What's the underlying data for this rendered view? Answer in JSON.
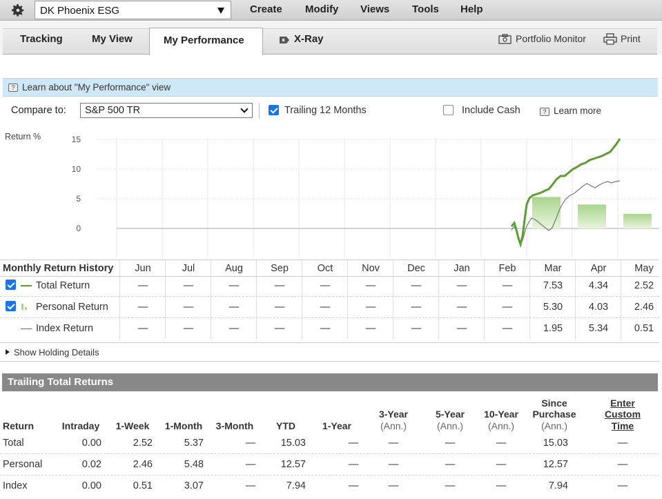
{
  "menubar": {
    "portfolio": "DK Phoenix ESG",
    "menus": [
      "Create",
      "Modify",
      "Views",
      "Tools",
      "Help"
    ]
  },
  "tabs": {
    "items": [
      "Tracking",
      "My View",
      "My Performance",
      "X-Ray"
    ],
    "active": "My Performance",
    "tools": [
      "Portfolio Monitor",
      "Print"
    ]
  },
  "learn": {
    "text": "Learn about \"My Performance\" view"
  },
  "compare": {
    "label": "Compare to:",
    "selected": "S&P 500 TR",
    "trailing_label": "Trailing 12 Months",
    "trailing_checked": true,
    "cash_label": "Include Cash",
    "cash_checked": false,
    "learn_more": "Learn more"
  },
  "chart_data": {
    "type": "line",
    "ylabel": "Return %",
    "yticks": [
      0,
      5,
      10,
      15
    ],
    "ylim": [
      -5,
      20
    ],
    "grid": true,
    "series": [
      {
        "name": "Total Return",
        "color": "#5a9e32",
        "kind": "line"
      },
      {
        "name": "Personal Return",
        "color": "#b9dd99",
        "kind": "bar"
      },
      {
        "name": "Index Return",
        "color": "#666666",
        "kind": "line"
      }
    ],
    "bars": [
      {
        "month": "Mar",
        "value": 5.3
      },
      {
        "month": "Apr",
        "value": 4.03
      },
      {
        "month": "May",
        "value": 2.46
      }
    ]
  },
  "monthly": {
    "title": "Monthly Return History",
    "months": [
      "Jun",
      "Jul",
      "Aug",
      "Sep",
      "Oct",
      "Nov",
      "Dec",
      "Jan",
      "Feb",
      "Mar",
      "Apr",
      "May"
    ],
    "rows": [
      {
        "label": "Total Return",
        "checked": true,
        "values": [
          "—",
          "—",
          "—",
          "—",
          "—",
          "—",
          "—",
          "—",
          "—",
          "7.53",
          "4.34",
          "2.52"
        ]
      },
      {
        "label": "Personal Return",
        "checked": true,
        "values": [
          "—",
          "—",
          "—",
          "—",
          "—",
          "—",
          "—",
          "—",
          "—",
          "5.30",
          "4.03",
          "2.46"
        ]
      },
      {
        "label": "Index Return",
        "checked": null,
        "values": [
          "—",
          "—",
          "—",
          "—",
          "—",
          "—",
          "—",
          "—",
          "—",
          "1.95",
          "5.34",
          "0.51"
        ]
      }
    ],
    "show_holding": "Show Holding Details"
  },
  "trailing": {
    "title": "Trailing Total Returns",
    "headers": {
      "return": "Return",
      "intraday": "Intraday",
      "w1": "1-Week",
      "m1": "1-Month",
      "m3": "3-Month",
      "ytd": "YTD",
      "y1": "1-Year",
      "y3": "3-Year",
      "y5": "5-Year",
      "y10": "10-Year",
      "ann": "(Ann.)",
      "since1": "Since",
      "since2": "Purchase",
      "custom1": "Enter",
      "custom2": "Custom",
      "custom3": "Time"
    },
    "rows": [
      {
        "label": "Total",
        "intraday": "0.00",
        "w1": "2.52",
        "m1": "5.37",
        "m3": "—",
        "ytd": "15.03",
        "y1": "—",
        "y3": "—",
        "y5": "—",
        "y10": "—",
        "since": "15.03",
        "custom": "—"
      },
      {
        "label": "Personal",
        "intraday": "0.02",
        "w1": "2.46",
        "m1": "5.48",
        "m3": "—",
        "ytd": "12.57",
        "y1": "—",
        "y3": "—",
        "y5": "—",
        "y10": "—",
        "since": "12.57",
        "custom": "—"
      },
      {
        "label": "Index",
        "intraday": "0.00",
        "w1": "0.51",
        "m1": "3.07",
        "m3": "—",
        "ytd": "7.94",
        "y1": "—",
        "y3": "—",
        "y5": "—",
        "y10": "—",
        "since": "7.94",
        "custom": "—"
      }
    ]
  }
}
